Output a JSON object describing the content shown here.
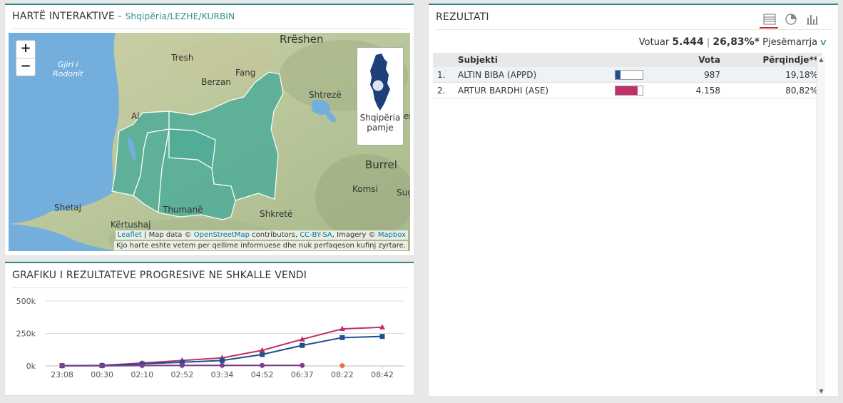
{
  "map_panel": {
    "title": "HARTË INTERAKTIVE",
    "separator": " - ",
    "path": "Shqipëria/LEZHE/KURBIN",
    "zoom_in": "+",
    "zoom_out": "−",
    "labels": {
      "rreshen": "Rrëshen",
      "tresh": "Tresh",
      "fang": "Fang",
      "berzan": "Berzan",
      "shtreze": "Shtrezë",
      "burrel": "Burrel",
      "komsi": "Komsi",
      "suc": "Suç",
      "shetaj": "Shetaj",
      "thumane": "Thumanë",
      "shkrete": "Shkretë",
      "kertushaj": "Kërtushaj",
      "al": "Al",
      "er": "er",
      "gjiri_1": "Gjiri i",
      "gjiri_2": "Rodonit"
    },
    "overview": {
      "line1": "Shqipëria",
      "line2": "pamje"
    },
    "attribution": {
      "leaflet": "Leaflet",
      "map_data": " | Map data © ",
      "osm": "OpenStreetMap",
      "contributors": " contributors, ",
      "license": "CC-BY-SA",
      "imagery": ", Imagery © ",
      "mapbox": "Mapbox"
    },
    "disclaimer": "Kjo harte eshte vetem per qellime informuese dhe nuk perfaqeson kufinj zyrtare."
  },
  "chart_panel": {
    "title": "GRAFIKU I REZULTATEVE PROGRESIVE NE SHKALLE VENDI"
  },
  "chart_data": {
    "type": "line",
    "categories": [
      "23:08",
      "00:30",
      "02:10",
      "02:52",
      "03:34",
      "04:52",
      "06:37",
      "08:22",
      "08:42"
    ],
    "ylim": [
      0,
      500000
    ],
    "yticks": [
      "0k",
      "250k",
      "500k"
    ],
    "series": [
      {
        "color": "#c0306a",
        "marker": "triangle",
        "values": [
          2000,
          4000,
          22000,
          42000,
          62000,
          120000,
          205000,
          285000,
          298000
        ]
      },
      {
        "color": "#1d4f91",
        "marker": "square",
        "values": [
          2000,
          3000,
          16000,
          28000,
          42000,
          88000,
          158000,
          218000,
          227000
        ]
      },
      {
        "color": "#7b3f8c",
        "marker": "circle",
        "values": [
          1000,
          1000,
          3000,
          4000,
          4000,
          4000,
          4000,
          null,
          null
        ]
      },
      {
        "color": "#e8734a",
        "marker": "circle",
        "values": [
          null,
          null,
          null,
          null,
          null,
          null,
          null,
          2000,
          null
        ]
      }
    ]
  },
  "results_panel": {
    "title": "REZULTATI",
    "icons": [
      "table-view-icon",
      "pie-chart-icon",
      "bar-chart-icon"
    ],
    "voted_label": "Votuar",
    "voted_value": "5.444",
    "separator": "|",
    "turnout_value": "26,83%*",
    "turnout_label": "Pjesëmarrja",
    "columns": {
      "subject": "Subjekti",
      "votes": "Vota",
      "percent": "Përqindje**"
    },
    "rows": [
      {
        "rank": "1.",
        "subject": "ALTIN BIBA (APPD)",
        "votes": "987",
        "percent": "19,18%",
        "share": 0.1918,
        "color": "#1d4f91"
      },
      {
        "rank": "2.",
        "subject": "ARTUR BARDHI (ASE)",
        "votes": "4.158",
        "percent": "80,82%",
        "share": 0.8082,
        "color": "#c0306a"
      }
    ]
  }
}
